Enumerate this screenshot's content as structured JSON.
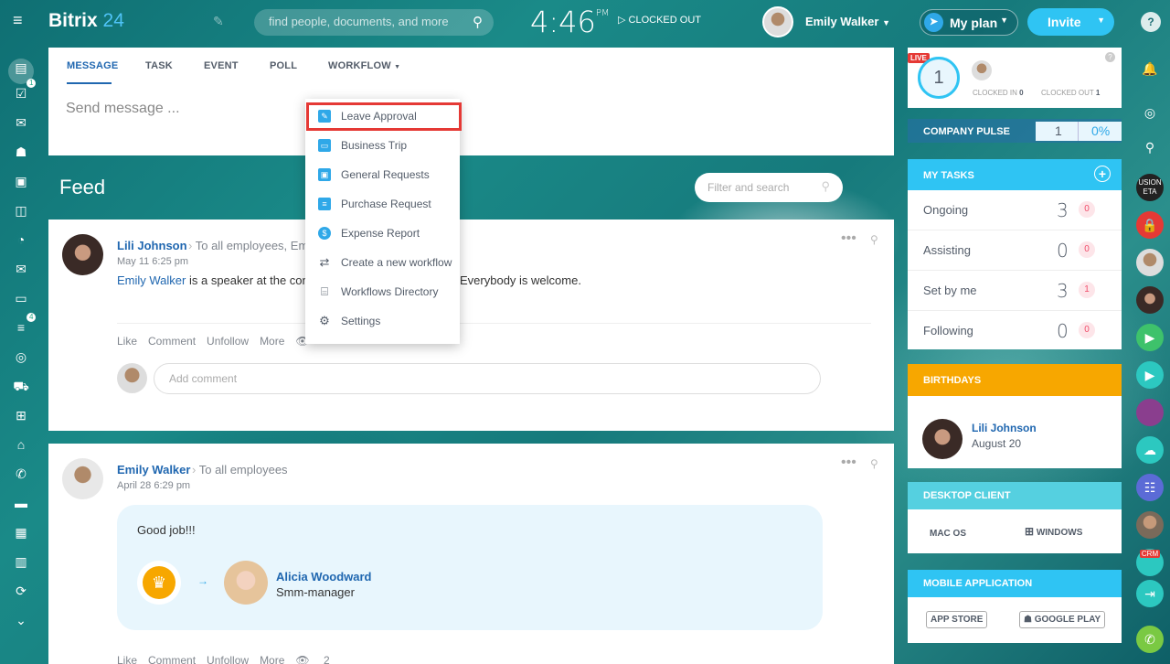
{
  "header": {
    "logo_main": "Bitrix",
    "logo_num": "24",
    "search_placeholder": "find people, documents, and more",
    "clock_time": "4:46",
    "clock_ampm": "PM",
    "clock_status": "CLOCKED OUT",
    "user_name": "Emily Walker",
    "my_plan_label": "My plan",
    "invite_label": "Invite",
    "help_label": "?"
  },
  "left_sidebar": {
    "badges": {
      "tasks": "1",
      "filter": "4"
    }
  },
  "composer": {
    "tabs": [
      "MESSAGE",
      "TASK",
      "EVENT",
      "POLL",
      "WORKFLOW"
    ],
    "placeholder": "Send message ..."
  },
  "workflow_menu": {
    "items": [
      {
        "label": "Leave Approval",
        "icon": "leave-approval-icon",
        "color": "#2fa8e8"
      },
      {
        "label": "Business Trip",
        "icon": "business-trip-icon",
        "color": "#2fa8e8"
      },
      {
        "label": "General Requests",
        "icon": "general-requests-icon",
        "color": "#2fa8e8"
      },
      {
        "label": "Purchase Request",
        "icon": "purchase-request-icon",
        "color": "#2fa8e8"
      },
      {
        "label": "Expense Report",
        "icon": "expense-report-icon",
        "color": "#2fa8e8"
      },
      {
        "label": "Create a new workflow",
        "icon": "create-workflow-icon",
        "color": "#535c69"
      },
      {
        "label": "Workflows Directory",
        "icon": "workflows-directory-icon",
        "color": "#535c69"
      },
      {
        "label": "Settings",
        "icon": "settings-icon",
        "color": "#535c69"
      }
    ],
    "highlight_color": "#e53935"
  },
  "feed": {
    "title": "Feed",
    "filter_placeholder": "Filter and search",
    "posts": [
      {
        "author": "Lili Johnson",
        "to": "To all employees, Em",
        "date": "May 11 6:25 pm",
        "mention": "Emily Walker",
        "text_a": " is a speaker at the conf",
        "text_b": "Everybody is welcome.",
        "actions": [
          "Like",
          "Comment",
          "Unfollow",
          "More"
        ],
        "comment_placeholder": "Add comment"
      },
      {
        "author": "Emily Walker",
        "to": "To all employees",
        "date": "April 28 6:29 pm",
        "message": "Good job!!!",
        "award_name": "Alicia Woodward",
        "award_role": "Smm-manager",
        "actions": [
          "Like",
          "Comment",
          "Unfollow",
          "More"
        ],
        "views": "2"
      }
    ]
  },
  "right_panel": {
    "timeman": {
      "live": "LIVE",
      "count": "1",
      "clocked_in_label": "CLOCKED IN",
      "clocked_in_value": "0",
      "clocked_out_label": "CLOCKED OUT",
      "clocked_out_value": "1"
    },
    "pulse": {
      "label": "COMPANY PULSE",
      "value": "1",
      "percent": "0%"
    },
    "tasks": {
      "title": "MY TASKS",
      "rows": [
        {
          "label": "Ongoing",
          "count": "3",
          "badge": "0"
        },
        {
          "label": "Assisting",
          "count": "0",
          "badge": "0"
        },
        {
          "label": "Set by me",
          "count": "3",
          "badge": "1"
        },
        {
          "label": "Following",
          "count": "0",
          "badge": "0"
        }
      ]
    },
    "birthdays": {
      "title": "BIRTHDAYS",
      "name": "Lili Johnson",
      "date": "August 20"
    },
    "desktop": {
      "title": "DESKTOP CLIENT",
      "mac": "MAC OS",
      "windows": "WINDOWS"
    },
    "mobile": {
      "title": "MOBILE APPLICATION",
      "appstore": "APP STORE",
      "googleplay": "GOOGLE PLAY"
    }
  },
  "right_bar": {
    "crm_label": "CRM",
    "usion_label": "USION ETA"
  },
  "colors": {
    "accent": "#2fc4f3",
    "link": "#2067b0",
    "tasks_head": "#2fc4f3",
    "birthdays_head": "#f7a700",
    "desktop_head": "#55d0e0"
  }
}
